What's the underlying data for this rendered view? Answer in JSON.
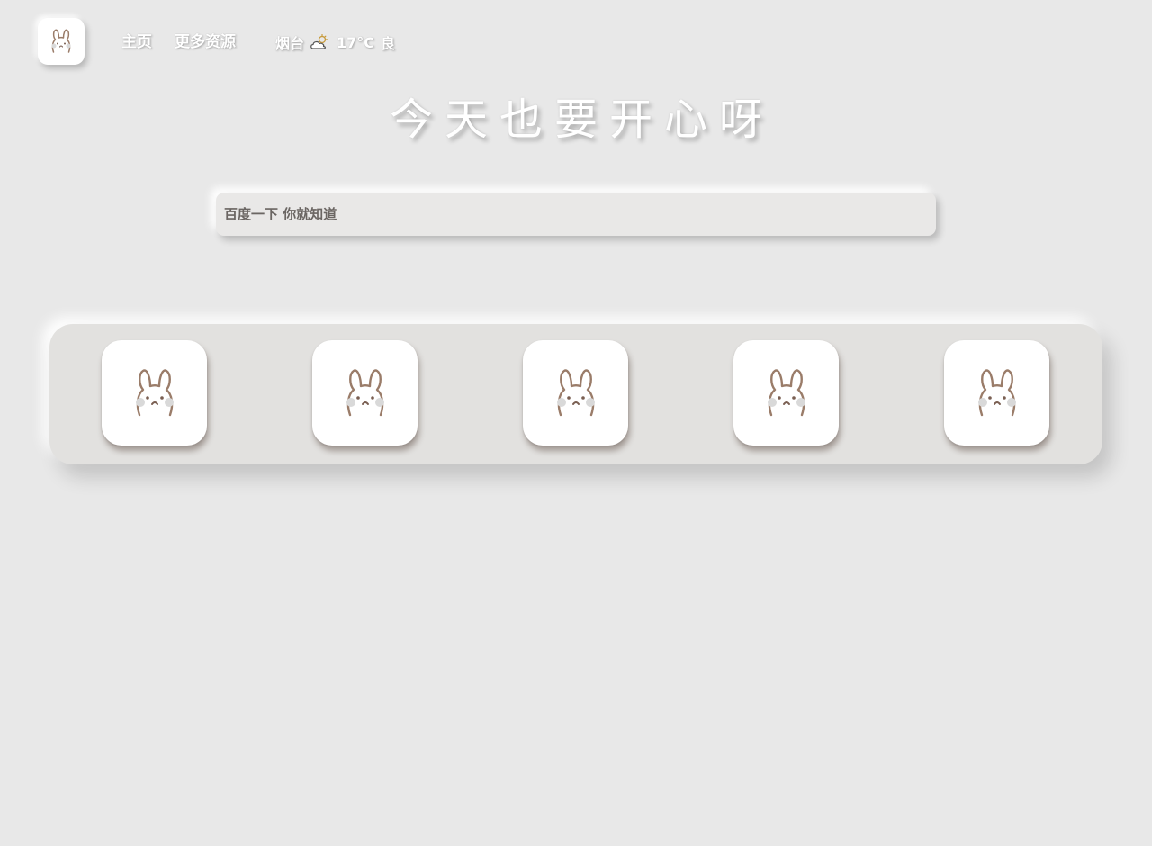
{
  "header": {
    "logo_icon": "bunny-icon",
    "nav": [
      {
        "label": "主页"
      },
      {
        "label": "更多资源"
      }
    ],
    "weather": {
      "city": "烟台",
      "icon": "partly-cloudy-icon",
      "temperature": "17°C",
      "air_quality": "良"
    }
  },
  "headline": "今天也要开心呀",
  "search": {
    "placeholder": "百度一下 你就知道"
  },
  "shelf": {
    "tiles": [
      {
        "icon": "bunny-icon"
      },
      {
        "icon": "bunny-icon"
      },
      {
        "icon": "bunny-icon"
      },
      {
        "icon": "bunny-icon"
      },
      {
        "icon": "bunny-icon"
      }
    ]
  },
  "colors": {
    "background": "#e8e8e8",
    "shelf": "#e2e1df",
    "tile": "#ffffff",
    "bunny_outline": "#9a7c69",
    "bunny_cheek": "#d9d9d9",
    "search_text": "#6b6663"
  }
}
